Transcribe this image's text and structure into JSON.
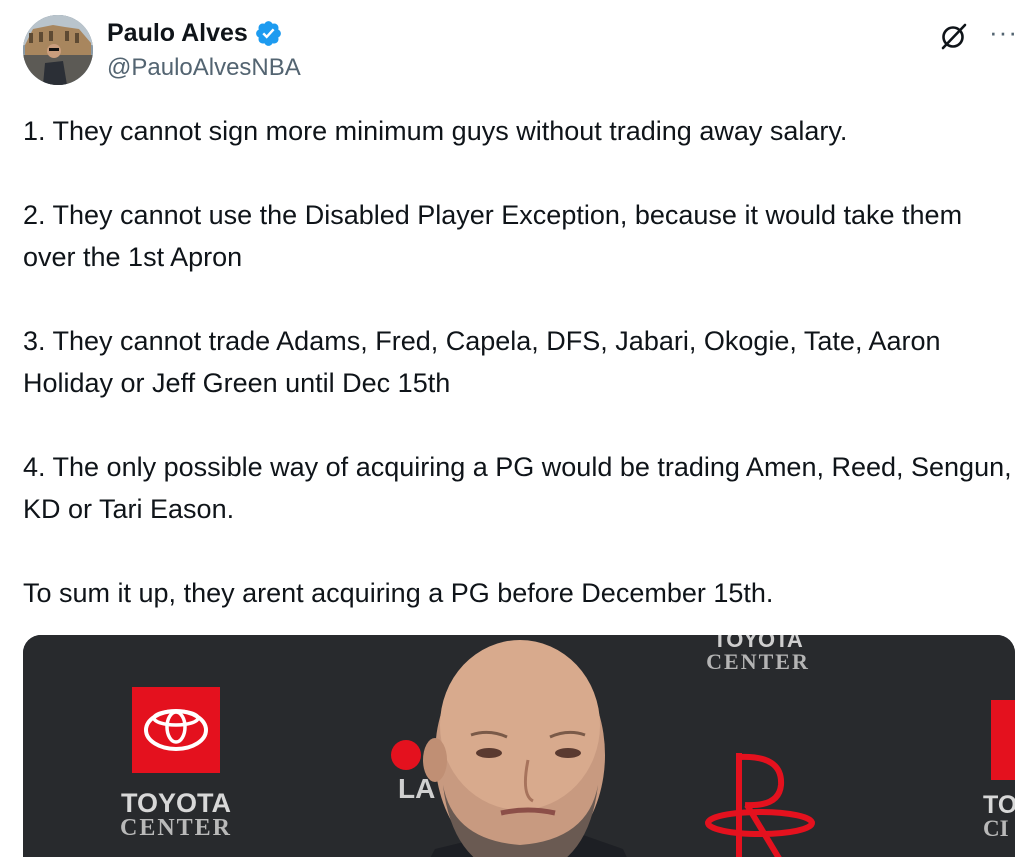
{
  "author": {
    "display_name": "Paulo Alves",
    "handle": "@PauloAlvesNBA",
    "verified": true,
    "verified_color": "#1d9bf0"
  },
  "actions": {
    "grok_icon": "grok-icon",
    "more_label": "···"
  },
  "tweet": {
    "paragraphs": [
      "1. They cannot sign more minimum guys without trading away salary.",
      "2. They cannot use the Disabled Player Exception, because it would take them over the 1st Apron",
      "3. They cannot trade Adams, Fred, Capela, DFS, Jabari, Okogie, Tate, Aaron Holiday or Jeff Green until Dec 15th",
      "4. The only possible way of acquiring a PG would be trading Amen, Reed, Sengun, KD or Tari Eason.",
      "To sum it up, they arent acquiring a PG before December 15th."
    ]
  },
  "media": {
    "signage": {
      "toyota": "TOYOTA",
      "center": "CENTER",
      "toyota_partial": "TO",
      "center_partial": "CI",
      "la": "LA"
    },
    "colors": {
      "toyota_red": "#e4111e",
      "backdrop": "#2a2c30"
    }
  }
}
